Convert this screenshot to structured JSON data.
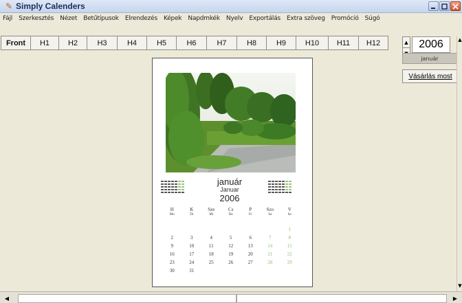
{
  "window": {
    "title": "Simply Calenders"
  },
  "menu": [
    "Fájl",
    "Szerkesztés",
    "Nézet",
    "Betűtípusok",
    "Elrendezés",
    "Képek",
    "Napdmkék",
    "Nyelv",
    "Exportálás",
    "Extra szöveg",
    "Promóció",
    "Súgó"
  ],
  "tabs": [
    "Front",
    "H1",
    "H2",
    "H3",
    "H4",
    "H5",
    "H6",
    "H7",
    "H8",
    "H9",
    "H10",
    "H11",
    "H12"
  ],
  "side": {
    "year": "2006",
    "month": "január",
    "buy_label": "Vásárlás most"
  },
  "calendar": {
    "month_hu": "január",
    "month_de": "Januar",
    "year": "2006",
    "weekdays": [
      {
        "hu": "H",
        "de": "Mo"
      },
      {
        "hu": "K",
        "de": "Di"
      },
      {
        "hu": "Sze",
        "de": "Mi"
      },
      {
        "hu": "Cs",
        "de": "Do"
      },
      {
        "hu": "P",
        "de": "Fr"
      },
      {
        "hu": "Szo",
        "de": "Sa"
      },
      {
        "hu": "V",
        "de": "So"
      }
    ],
    "weeks": [
      [
        "",
        "",
        "",
        "",
        "",
        "",
        "1"
      ],
      [
        "2",
        "3",
        "4",
        "5",
        "6",
        "7",
        "8"
      ],
      [
        "9",
        "10",
        "11",
        "12",
        "13",
        "14",
        "15"
      ],
      [
        "16",
        "17",
        "18",
        "19",
        "20",
        "21",
        "22"
      ],
      [
        "23",
        "24",
        "25",
        "26",
        "27",
        "28",
        "29"
      ],
      [
        "30",
        "31",
        "",
        "",
        "",
        "",
        ""
      ]
    ]
  },
  "colors": {
    "weekend": "#8fbf6a",
    "titlebar": "#c6d6ee"
  }
}
